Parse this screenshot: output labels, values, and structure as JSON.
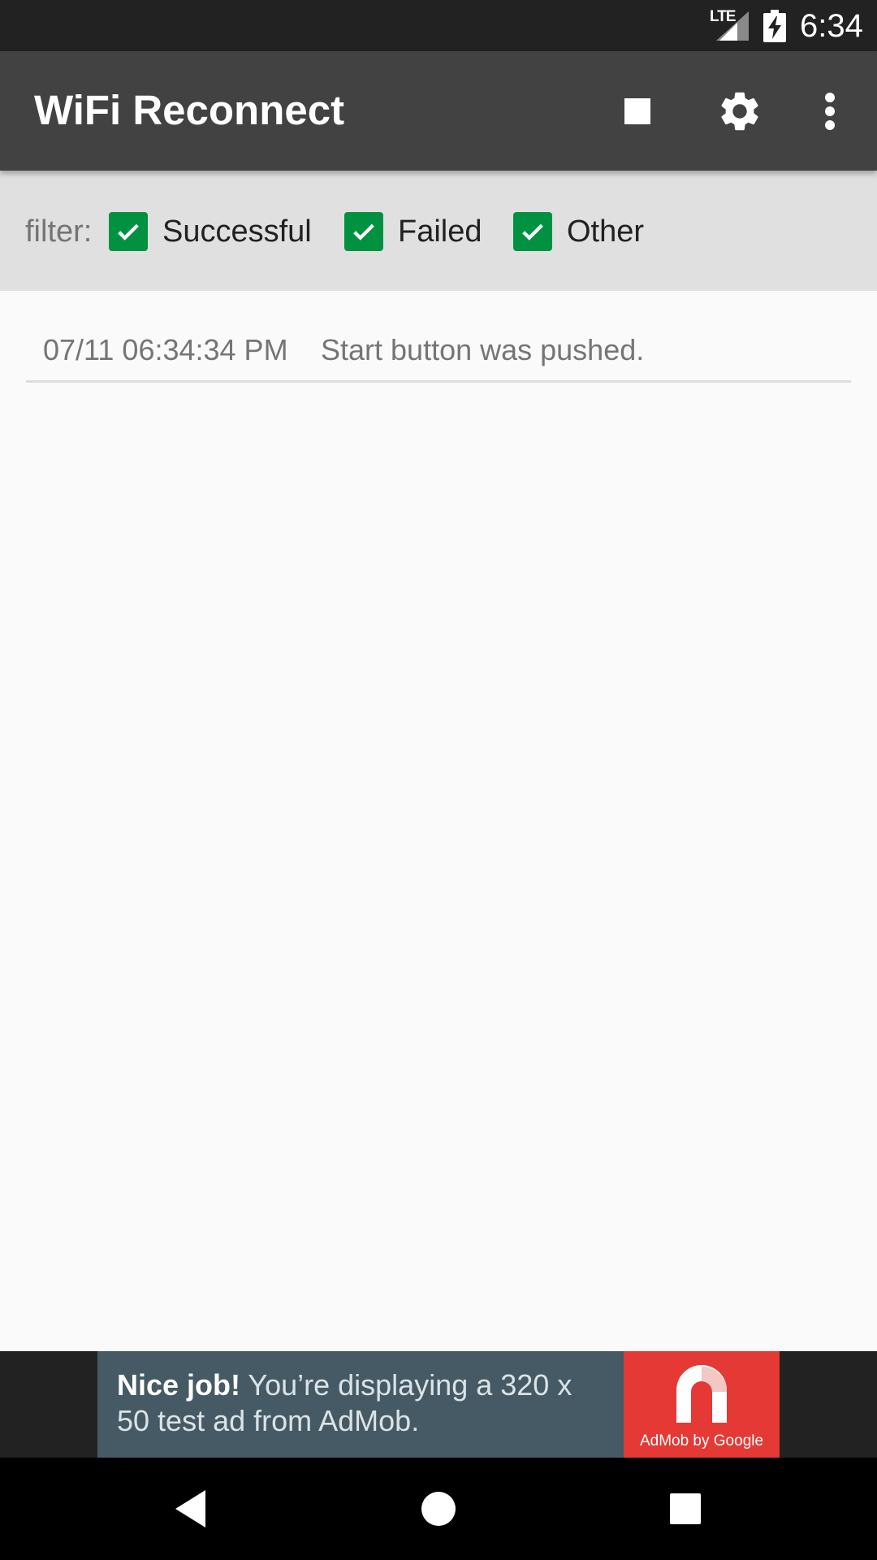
{
  "status_bar": {
    "network_label": "LTE",
    "time": "6:34",
    "icons": [
      "lte-signal-icon",
      "battery-charging-icon"
    ]
  },
  "app_bar": {
    "title": "WiFi Reconnect",
    "actions": [
      {
        "name": "stop",
        "icon": "stop-icon"
      },
      {
        "name": "settings",
        "icon": "gear-icon"
      },
      {
        "name": "overflow-menu",
        "icon": "more-vert-icon"
      }
    ]
  },
  "filter": {
    "label": "filter:",
    "options": [
      {
        "label": "Successful",
        "checked": true
      },
      {
        "label": "Failed",
        "checked": true
      },
      {
        "label": "Other",
        "checked": true
      }
    ],
    "check_color": "#009241"
  },
  "log": {
    "entries": [
      {
        "time": "07/11 06:34:34 PM",
        "message": "Start button was pushed."
      }
    ]
  },
  "ad": {
    "headline_bold": "Nice job!",
    "headline_rest": " You’re displaying a 320 x 50 test ad from AdMob.",
    "logo_text": "AdMob by Google",
    "banner_color": "#455a64",
    "logo_color": "#e53935"
  },
  "nav_bar": {
    "buttons": [
      {
        "name": "back",
        "icon": "back-triangle-icon"
      },
      {
        "name": "home",
        "icon": "home-circle-icon"
      },
      {
        "name": "recents",
        "icon": "recents-square-icon"
      }
    ]
  },
  "colors": {
    "app_bar": "#424242",
    "filter_bar": "#e0e0e0",
    "background": "#fafafa",
    "status_bar": "#222222"
  }
}
